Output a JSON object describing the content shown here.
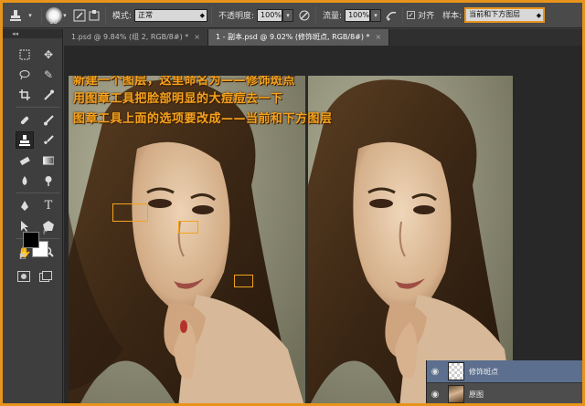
{
  "options_bar": {
    "brush_size": "90",
    "mode_label": "模式:",
    "mode_value": "正常",
    "opacity_label": "不透明度:",
    "opacity_value": "100%",
    "flow_label": "流量:",
    "flow_value": "100%",
    "aligned_label": "对齐",
    "aligned_checked": true,
    "sample_label": "样本:",
    "sample_value": "当前和下方图层"
  },
  "tabs": [
    {
      "label": "1.psd @ 9.84% (组 2, RGB/8#) *",
      "close": "×"
    },
    {
      "label": "1 - 副本.psd @ 9.02% (修饰斑点, RGB/8#) *",
      "close": "×"
    }
  ],
  "annotations": [
    "新建一个图层，这里命名为——修饰斑点",
    "用图章工具把脸部明显的大痘痘去一下",
    "图章工具上面的选项要改成——当前和下方图层"
  ],
  "layers": [
    {
      "name": "修饰斑点",
      "selected": true
    },
    {
      "name": "原图",
      "selected": false
    }
  ],
  "colors": {
    "highlight": "#e8941c",
    "annotation_text": "#f4a21e",
    "foreground": "#000000",
    "background": "#ffffff"
  },
  "icons": [
    "clone-stamp-icon",
    "brush-preset-icon",
    "clone-source-icon",
    "airbrush-icon",
    "pressure-icon"
  ]
}
